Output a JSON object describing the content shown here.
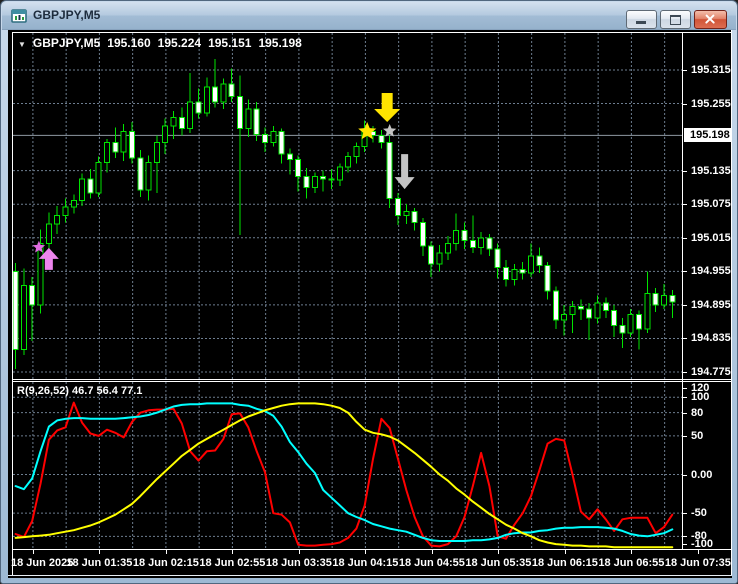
{
  "window": {
    "title": "GBPJPY,M5"
  },
  "chart_header": {
    "dropdown": "▼",
    "symbol": "GBPJPY,M5",
    "open": "195.160",
    "high": "195.224",
    "low": "195.151",
    "close": "195.198"
  },
  "price_scale": {
    "labels": [
      "195.315",
      "195.255",
      "195.135",
      "195.075",
      "195.015",
      "194.955",
      "194.895",
      "194.835",
      "194.775"
    ],
    "marker": "195.198"
  },
  "time_axis": {
    "labels": [
      "18 Jun 2025",
      "18 Jun 01:35",
      "18 Jun 02:15",
      "18 Jun 02:55",
      "18 Jun 03:35",
      "18 Jun 04:15",
      "18 Jun 04:55",
      "18 Jun 05:35",
      "18 Jun 06:15",
      "18 Jun 06:55",
      "18 Jun 07:35"
    ]
  },
  "indicator_pane": {
    "label": "R(9,26,52) 46.7 56.4 77.1",
    "scale_labels": [
      {
        "text": "120",
        "v": 120
      },
      {
        "text": "100",
        "v": 100
      },
      {
        "text": "80",
        "v": 80
      },
      {
        "text": "50",
        "v": 50
      },
      {
        "text": "0.00",
        "v": 0
      },
      {
        "text": "-50",
        "v": -50
      },
      {
        "text": "-80",
        "v": -80
      },
      {
        "text": "-100",
        "v": -100
      }
    ],
    "levels": [
      100,
      80,
      50,
      0,
      -50,
      -80
    ]
  },
  "colors": {
    "background": "#000000",
    "grid": "#6e7e90",
    "candle_border": "#00e400",
    "bull_fill": "#000000",
    "bear_fill": "#ffffff",
    "price_line": "#8f99a3",
    "red_line": "#ff0000",
    "cyan_line": "#00ffff",
    "yellow_line": "#ffff00",
    "marker_yellow": "#ffe400",
    "marker_silver": "#c4c4c4",
    "marker_magenta": "#e06ce0",
    "marker_pink": "#ee85ee"
  },
  "chart_data": {
    "type": "candlestick",
    "symbol": "GBPJPY",
    "timeframe": "M5",
    "date": "18 Jun 2025",
    "price_axis_range": [
      194.775,
      195.315
    ],
    "candle_columns": [
      "time",
      "open",
      "high",
      "low",
      "close"
    ],
    "candles": [
      [
        "00:45",
        194.955,
        194.97,
        194.78,
        194.815
      ],
      [
        "00:50",
        194.815,
        194.96,
        194.805,
        194.93
      ],
      [
        "00:55",
        194.93,
        194.945,
        194.83,
        194.895
      ],
      [
        "01:00",
        194.895,
        195.03,
        194.88,
        195.005
      ],
      [
        "01:05",
        195.005,
        195.06,
        194.99,
        195.04
      ],
      [
        "01:10",
        195.04,
        195.072,
        195.022,
        195.055
      ],
      [
        "01:15",
        195.055,
        195.085,
        195.042,
        195.07
      ],
      [
        "01:20",
        195.07,
        195.092,
        195.058,
        195.082
      ],
      [
        "01:25",
        195.082,
        195.13,
        195.072,
        195.12
      ],
      [
        "01:30",
        195.12,
        195.138,
        195.085,
        195.095
      ],
      [
        "01:35",
        195.095,
        195.16,
        195.088,
        195.15
      ],
      [
        "01:40",
        195.15,
        195.192,
        195.132,
        195.185
      ],
      [
        "01:45",
        195.185,
        195.212,
        195.158,
        195.168
      ],
      [
        "01:50",
        195.168,
        195.218,
        195.152,
        195.205
      ],
      [
        "01:55",
        195.205,
        195.222,
        195.148,
        195.158
      ],
      [
        "02:00",
        195.158,
        195.172,
        195.088,
        195.1
      ],
      [
        "02:05",
        195.1,
        195.162,
        195.082,
        195.15
      ],
      [
        "02:10",
        195.15,
        195.198,
        195.095,
        195.185
      ],
      [
        "02:15",
        195.185,
        195.228,
        195.165,
        195.215
      ],
      [
        "02:20",
        195.215,
        195.242,
        195.192,
        195.23
      ],
      [
        "02:25",
        195.23,
        195.248,
        195.198,
        195.21
      ],
      [
        "02:30",
        195.21,
        195.31,
        195.202,
        195.258
      ],
      [
        "02:35",
        195.258,
        195.282,
        195.228,
        195.238
      ],
      [
        "02:40",
        195.238,
        195.302,
        195.232,
        195.285
      ],
      [
        "02:45",
        195.285,
        195.335,
        195.248,
        195.258
      ],
      [
        "02:50",
        195.258,
        195.3,
        195.245,
        195.29
      ],
      [
        "02:55",
        195.29,
        195.318,
        195.258,
        195.268
      ],
      [
        "03:00",
        195.268,
        195.305,
        195.02,
        195.21
      ],
      [
        "03:05",
        195.21,
        195.262,
        195.195,
        195.245
      ],
      [
        "03:10",
        195.245,
        195.258,
        195.188,
        195.2
      ],
      [
        "03:15",
        195.2,
        195.212,
        195.168,
        195.185
      ],
      [
        "03:20",
        195.185,
        195.215,
        195.178,
        195.205
      ],
      [
        "03:25",
        195.205,
        195.21,
        195.148,
        195.165
      ],
      [
        "03:30",
        195.165,
        195.175,
        195.128,
        195.155
      ],
      [
        "03:35",
        195.155,
        195.162,
        195.098,
        195.125
      ],
      [
        "03:40",
        195.125,
        195.14,
        195.085,
        195.105
      ],
      [
        "03:45",
        195.105,
        195.132,
        195.095,
        195.125
      ],
      [
        "03:50",
        195.125,
        195.135,
        195.098,
        195.12
      ],
      [
        "03:55",
        195.12,
        195.138,
        195.102,
        195.118
      ],
      [
        "04:00",
        195.118,
        195.148,
        195.108,
        195.142
      ],
      [
        "04:05",
        195.142,
        195.168,
        195.132,
        195.16
      ],
      [
        "04:10",
        195.16,
        195.185,
        195.148,
        195.178
      ],
      [
        "04:15",
        195.178,
        195.225,
        195.168,
        195.205
      ],
      [
        "04:20",
        195.205,
        195.215,
        195.185,
        195.198
      ],
      [
        "04:25",
        195.198,
        195.208,
        195.175,
        195.185
      ],
      [
        "04:30",
        195.185,
        195.198,
        195.068,
        195.085
      ],
      [
        "04:35",
        195.085,
        195.095,
        195.038,
        195.055
      ],
      [
        "04:40",
        195.055,
        195.075,
        195.04,
        195.062
      ],
      [
        "04:45",
        195.062,
        195.068,
        195.028,
        195.042
      ],
      [
        "04:50",
        195.042,
        195.05,
        194.982,
        195.0
      ],
      [
        "04:55",
        195.0,
        195.008,
        194.945,
        194.968
      ],
      [
        "05:00",
        194.968,
        195.002,
        194.955,
        194.988
      ],
      [
        "05:05",
        194.988,
        195.018,
        194.975,
        195.005
      ],
      [
        "05:10",
        195.005,
        195.058,
        194.992,
        195.028
      ],
      [
        "05:15",
        195.028,
        195.042,
        194.995,
        195.01
      ],
      [
        "05:20",
        195.01,
        195.055,
        194.988,
        194.998
      ],
      [
        "05:25",
        194.998,
        195.025,
        194.985,
        195.015
      ],
      [
        "05:30",
        195.015,
        195.022,
        194.982,
        194.995
      ],
      [
        "05:35",
        194.995,
        195.005,
        194.942,
        194.962
      ],
      [
        "05:40",
        194.962,
        194.975,
        194.928,
        194.94
      ],
      [
        "05:45",
        194.94,
        194.968,
        194.93,
        194.958
      ],
      [
        "05:50",
        194.958,
        194.972,
        194.94,
        194.952
      ],
      [
        "05:55",
        194.952,
        195.005,
        194.945,
        194.982
      ],
      [
        "06:00",
        194.982,
        194.998,
        194.952,
        194.965
      ],
      [
        "06:05",
        194.965,
        194.972,
        194.905,
        194.92
      ],
      [
        "06:10",
        194.92,
        194.928,
        194.852,
        194.868
      ],
      [
        "06:15",
        194.868,
        194.895,
        194.84,
        194.878
      ],
      [
        "06:20",
        194.878,
        194.902,
        194.845,
        194.892
      ],
      [
        "06:25",
        194.892,
        194.905,
        194.868,
        194.888
      ],
      [
        "06:30",
        194.888,
        194.898,
        194.832,
        194.872
      ],
      [
        "06:35",
        194.872,
        194.912,
        194.862,
        194.898
      ],
      [
        "06:40",
        194.898,
        194.908,
        194.872,
        194.885
      ],
      [
        "06:45",
        194.885,
        194.895,
        194.838,
        194.858
      ],
      [
        "06:50",
        194.858,
        194.872,
        194.818,
        194.845
      ],
      [
        "06:55",
        194.845,
        194.888,
        194.838,
        194.878
      ],
      [
        "07:00",
        194.878,
        194.885,
        194.815,
        194.852
      ],
      [
        "07:05",
        194.852,
        194.955,
        194.845,
        194.915
      ],
      [
        "07:10",
        194.915,
        194.925,
        194.882,
        194.895
      ],
      [
        "07:15",
        194.895,
        194.932,
        194.888,
        194.912
      ],
      [
        "07:20",
        194.912,
        194.922,
        194.872,
        194.9
      ]
    ],
    "indicator": {
      "name": "R(9,26,52)",
      "value_range": [
        -100,
        120
      ],
      "series": [
        {
          "name": "fast",
          "color": "#ff0000",
          "values": [
            -77,
            -81,
            -60,
            -12,
            45,
            57,
            61,
            93,
            67,
            53,
            50,
            58,
            54,
            48,
            68,
            80,
            83,
            84,
            84,
            85,
            66,
            30,
            18,
            30,
            31,
            46,
            78,
            79,
            61,
            30,
            3,
            -50,
            -52,
            -62,
            -91,
            -92,
            -92,
            -91,
            -90,
            -88,
            -82,
            -70,
            -40,
            20,
            72,
            60,
            20,
            -20,
            -55,
            -80,
            -92,
            -93,
            -90,
            -80,
            -55,
            -15,
            28,
            -15,
            -80,
            -83,
            -65,
            -50,
            -28,
            5,
            40,
            46,
            44,
            0,
            -48,
            -58,
            -45,
            -58,
            -73,
            -58,
            -56,
            -56,
            -56,
            -76,
            -68,
            -52
          ]
        },
        {
          "name": "medium",
          "color": "#00ffff",
          "values": [
            -15,
            -19,
            -5,
            30,
            62,
            70,
            72,
            73,
            73,
            72,
            72,
            72,
            72,
            73,
            74,
            75,
            77,
            80,
            84,
            88,
            90,
            91,
            91,
            92,
            92,
            92,
            92,
            90,
            89,
            85,
            82,
            76,
            62,
            42,
            29,
            14,
            2,
            -20,
            -30,
            -40,
            -50,
            -55,
            -59,
            -64,
            -67,
            -70,
            -72,
            -74,
            -78,
            -82,
            -85,
            -86,
            -86,
            -86,
            -86,
            -85,
            -85,
            -84,
            -82,
            -78,
            -76,
            -75,
            -75,
            -73,
            -72,
            -70,
            -69,
            -69,
            -68,
            -68,
            -68,
            -69,
            -70,
            -73,
            -77,
            -79,
            -80,
            -78,
            -76,
            -71
          ]
        },
        {
          "name": "slow",
          "color": "#ffff00",
          "values": [
            -82,
            -81,
            -80,
            -79,
            -78,
            -76,
            -74,
            -72,
            -69,
            -66,
            -62,
            -57,
            -52,
            -45,
            -38,
            -28,
            -17,
            -6,
            4,
            14,
            24,
            32,
            40,
            46,
            52,
            58,
            64,
            70,
            75,
            79,
            83,
            86,
            89,
            91,
            92,
            92,
            92,
            91,
            89,
            86,
            80,
            68,
            58,
            54,
            52,
            49,
            44,
            36,
            28,
            19,
            10,
            0,
            -8,
            -18,
            -26,
            -35,
            -43,
            -51,
            -58,
            -65,
            -70,
            -76,
            -80,
            -85,
            -88,
            -90,
            -91,
            -92,
            -92,
            -93,
            -93,
            -93,
            -94,
            -94,
            -94,
            -94,
            -94,
            -94,
            -94,
            -94
          ]
        }
      ]
    },
    "markers": [
      {
        "shape": "star",
        "color": "#e06ce0",
        "x_index": 2.8,
        "price": 194.998,
        "size": 6.5
      },
      {
        "shape": "arrow-up",
        "color": "#ee85ee",
        "x_index": 4.0,
        "price": 194.997
      },
      {
        "shape": "star",
        "color": "#ffe400",
        "x_index": 42.3,
        "price": 195.205,
        "size": 9.5
      },
      {
        "shape": "star",
        "color": "#c4c4c4",
        "x_index": 45.0,
        "price": 195.206,
        "size": 7
      },
      {
        "shape": "arrow-down-big",
        "color": "#ffe400",
        "x_index": 44.7,
        "price": 195.222
      },
      {
        "shape": "arrow-down",
        "color": "#c4c4c4",
        "x_index": 46.8,
        "price": 195.102
      }
    ]
  }
}
